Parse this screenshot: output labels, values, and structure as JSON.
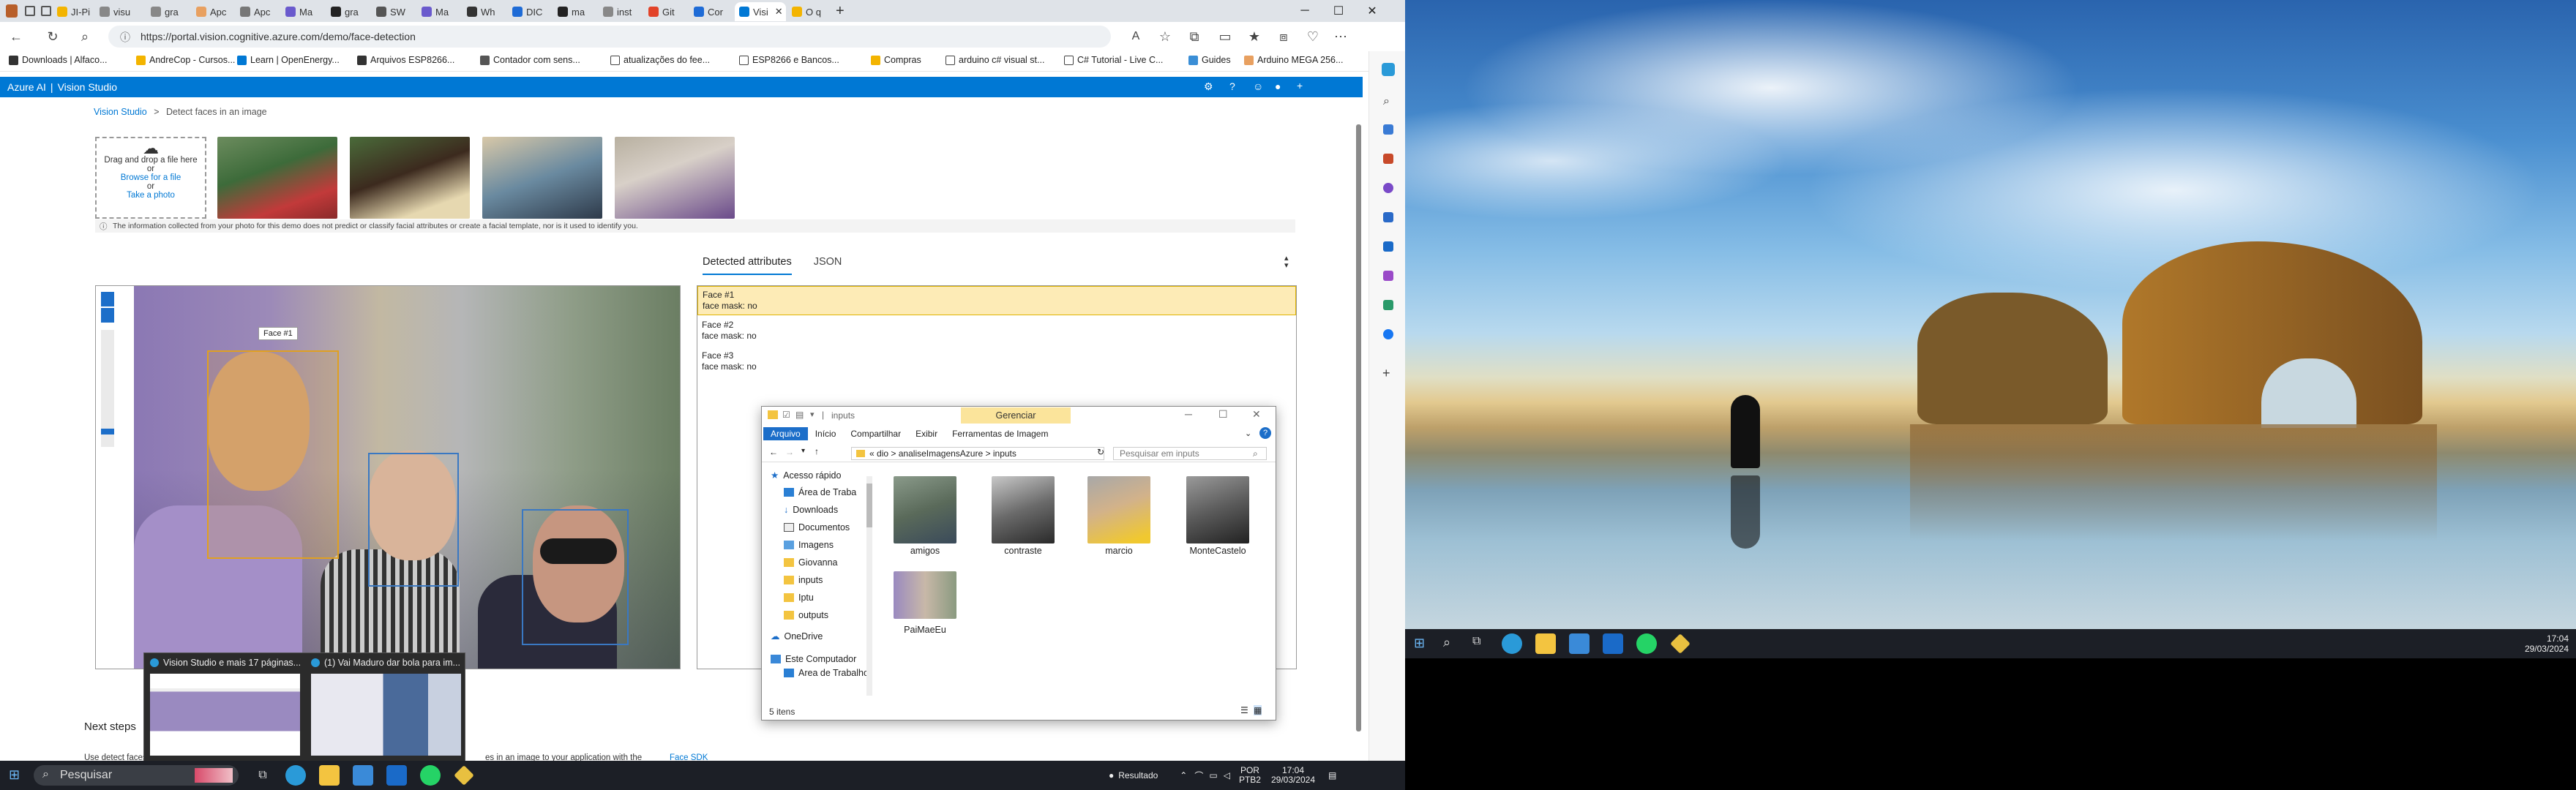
{
  "browser": {
    "tabs": [
      "JI-Pi",
      "visu",
      "gra",
      "Apc",
      "Apc",
      "Ma",
      "gra",
      "SW",
      "Ma",
      "Wh",
      "DIC",
      "ma",
      "inst",
      "Git",
      "Cor",
      "Visi",
      "O q"
    ],
    "url": "https://portal.vision.cognitive.azure.com/demo/face-detection",
    "favorites": [
      "Downloads | Alfaco...",
      "AndreCop - Cursos...",
      "Learn | OpenEnergy...",
      "Arquivos ESP8266...",
      "Contador com sens...",
      "atualizações do fee...",
      "ESP8266 e Bancos...",
      "Compras",
      "arduino c# visual st...",
      "C# Tutorial - Live C...",
      "Guides",
      "Arduino MEGA 256..."
    ]
  },
  "azure": {
    "brand": "Azure AI",
    "product": "Vision Studio",
    "breadcrumb_root": "Vision Studio",
    "breadcrumb_sep": ">",
    "breadcrumb_current": "Detect faces in an image"
  },
  "upload": {
    "drag_text": "Drag and drop a file here",
    "or1": "or",
    "browse": "Browse for a file",
    "or2": "or",
    "take_photo": "Take a photo"
  },
  "info_notice": "The information collected from your photo for this demo does not predict or classify facial attributes or create a facial template, nor is it used to identify you.",
  "result_tabs": {
    "detected": "Detected attributes",
    "json": "JSON"
  },
  "face_label": "Face #1",
  "faces": [
    {
      "title": "Face #1",
      "attr": "face mask: no"
    },
    {
      "title": "Face #2",
      "attr": "face mask: no"
    },
    {
      "title": "Face #3",
      "attr": "face mask: no"
    }
  ],
  "next_steps": {
    "heading": "Next steps",
    "desc_start": "Use detect faces",
    "desc_end": "es in an image to your application with the",
    "sdk_link": "Face SDK"
  },
  "explorer": {
    "title": "inputs",
    "context_tab": "Gerenciar",
    "ribbon": [
      "Arquivo",
      "Início",
      "Compartilhar",
      "Exibir",
      "Ferramentas de Imagem"
    ],
    "path": [
      "«",
      "dio",
      ">",
      "analiseImagensAzure",
      ">",
      "inputs"
    ],
    "search_placeholder": "Pesquisar em inputs",
    "nav": [
      "Acesso rápido",
      "Área de Traba",
      "Downloads",
      "Documentos",
      "Imagens",
      "Giovanna",
      "inputs",
      "Iptu",
      "outputs",
      "OneDrive",
      "Este Computador",
      "Área de Trabalho"
    ],
    "files": [
      "amigos",
      "contraste",
      "marcio",
      "MonteCastelo",
      "PaiMaeEu"
    ],
    "status": "5 itens"
  },
  "previews": [
    {
      "title": "Vision Studio e mais 17 páginas..."
    },
    {
      "title": "(1) Vai Maduro dar bola para im..."
    }
  ],
  "taskbar_left": {
    "search": "Pesquisar",
    "status_item": "Resultado",
    "lang1": "POR",
    "lang2": "PTB2",
    "time": "17:04",
    "date": "29/03/2024"
  },
  "taskbar_right": {
    "time": "17:04",
    "date": "29/03/2024"
  },
  "colors": {
    "azure_blue": "#0078d4",
    "face1": "#e0a020",
    "face_other": "#3a78c2",
    "selected_row": "#fdebb6"
  }
}
